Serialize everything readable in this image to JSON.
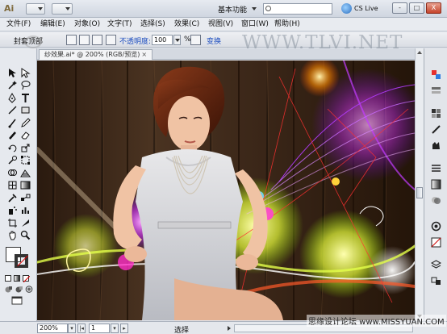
{
  "app": {
    "logo": "Ai",
    "workspace": "基本功能",
    "cs_live": "CS Live",
    "search_placeholder": "",
    "window_controls": [
      "-",
      "□",
      "X"
    ]
  },
  "menu": [
    "文件(F)",
    "编辑(E)",
    "对象(O)",
    "文字(T)",
    "选择(S)",
    "效果(C)",
    "视图(V)",
    "窗口(W)",
    "帮助(H)"
  ],
  "control_bar": {
    "label": "封套顶部",
    "opacity_label": "不透明度:",
    "opacity_value": "100",
    "opacity_unit": "%",
    "transform_label": "变换"
  },
  "watermark": "WWW.TLVI.NET",
  "document_tab": {
    "title": "纱效果.ai* @ 200% (RGB/预览)",
    "close": "×"
  },
  "status_bar": {
    "zoom": "200%",
    "page": "1",
    "status": "选择"
  },
  "site_watermark": "思缘设计论坛 www.MISSYUAN.COM",
  "icons": {
    "tools": [
      "selection-tool",
      "direct-selection-tool",
      "magic-wand-tool",
      "lasso-tool",
      "pen-tool",
      "type-tool",
      "line-tool",
      "rectangle-tool",
      "paintbrush-tool",
      "pencil-tool",
      "blob-brush-tool",
      "eraser-tool",
      "rotate-tool",
      "scale-tool",
      "warp-tool",
      "free-transform-tool",
      "shape-builder-tool",
      "perspective-grid-tool",
      "mesh-tool",
      "gradient-tool",
      "eyedropper-tool",
      "blend-tool",
      "symbol-sprayer-tool",
      "column-graph-tool",
      "artboard-tool",
      "slice-tool",
      "hand-tool",
      "zoom-tool"
    ],
    "dock": [
      "color-panel",
      "color-guide-panel",
      "swatches-panel",
      "brushes-panel",
      "symbols-panel",
      "stroke-panel",
      "gradient-panel",
      "transparency-panel",
      "appearance-panel",
      "graphic-styles-panel",
      "layers-panel",
      "artboards-panel"
    ]
  }
}
